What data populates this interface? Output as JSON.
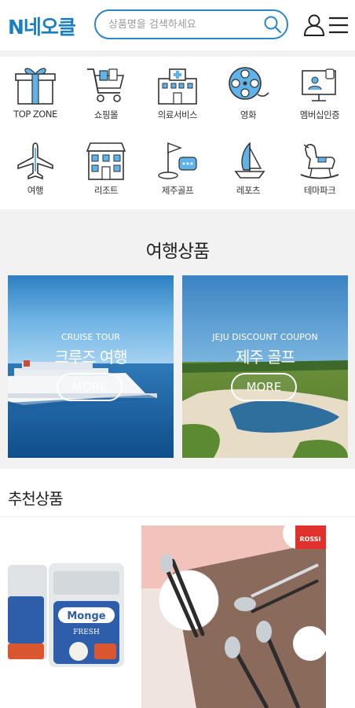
{
  "header": {
    "logo": "N네오클",
    "search_placeholder": "상품명을 검색하세요"
  },
  "categories": [
    {
      "label": "TOP ZONE",
      "icon": "gift-box-icon"
    },
    {
      "label": "쇼핑몰",
      "icon": "shopping-cart-icon"
    },
    {
      "label": "의료서비스",
      "icon": "hospital-icon"
    },
    {
      "label": "영화",
      "icon": "film-reel-icon"
    },
    {
      "label": "멤버십인증",
      "icon": "membership-screen-icon"
    },
    {
      "label": "여행",
      "icon": "airplane-icon"
    },
    {
      "label": "리조트",
      "icon": "resort-building-icon"
    },
    {
      "label": "제주골프",
      "icon": "golf-flag-icon"
    },
    {
      "label": "레포츠",
      "icon": "sailboat-icon"
    },
    {
      "label": "테마파크",
      "icon": "rocking-horse-icon"
    }
  ],
  "travel": {
    "title": "여행상품",
    "cards": [
      {
        "subtitle": "CRUISE TOUR",
        "title": "크루즈 여행",
        "button": "MORE"
      },
      {
        "subtitle": "JEJU DISCOUNT COUPON",
        "title": "제주 골프",
        "button": "MORE"
      }
    ]
  },
  "recommend": {
    "title": "추천상품",
    "products": [
      {
        "brand": "Monge",
        "sub": "FRESH"
      },
      {
        "brand": "ROSSI"
      }
    ]
  }
}
